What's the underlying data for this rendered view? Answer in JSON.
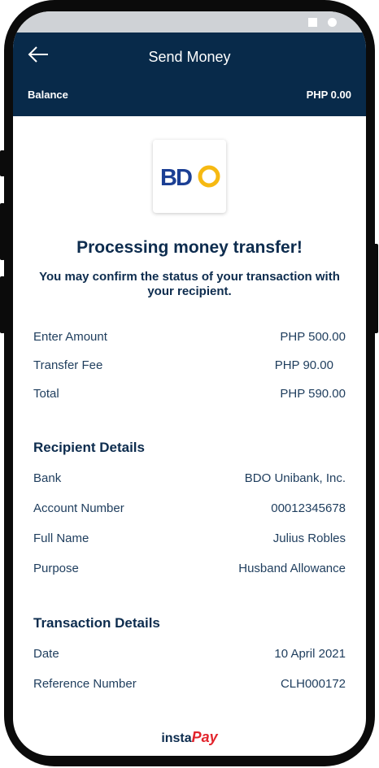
{
  "header": {
    "title": "Send Money",
    "balance_label": "Balance",
    "balance_value": "PHP 0.00"
  },
  "bank_logo": {
    "text": "BDO"
  },
  "heading": "Processing money transfer!",
  "subheading": "You may confirm the status of your transaction with your recipient.",
  "amounts": [
    {
      "label": "Enter Amount",
      "value": "PHP 500.00"
    },
    {
      "label": "Transfer Fee",
      "value": "PHP 90.00"
    },
    {
      "label": "Total",
      "value": "PHP 590.00"
    }
  ],
  "recipient": {
    "title": "Recipient Details",
    "rows": [
      {
        "label": "Bank",
        "value": "BDO Unibank, Inc."
      },
      {
        "label": "Account Number",
        "value": "00012345678"
      },
      {
        "label": "Full Name",
        "value": "Julius Robles"
      },
      {
        "label": "Purpose",
        "value": "Husband Allowance"
      }
    ]
  },
  "transaction": {
    "title": "Transaction Details",
    "rows": [
      {
        "label": "Date",
        "value": "10 April 2021"
      },
      {
        "label": "Reference Number",
        "value": "CLH000172"
      }
    ]
  },
  "footer": {
    "brand_prefix": "insta",
    "brand_suffix": "Pay"
  },
  "colors": {
    "header_bg": "#082a4a",
    "text_dark": "#0d2c4e",
    "bdo_blue": "#1b3f94",
    "bdo_yellow": "#f6b912",
    "instapay_red": "#e2242c"
  }
}
